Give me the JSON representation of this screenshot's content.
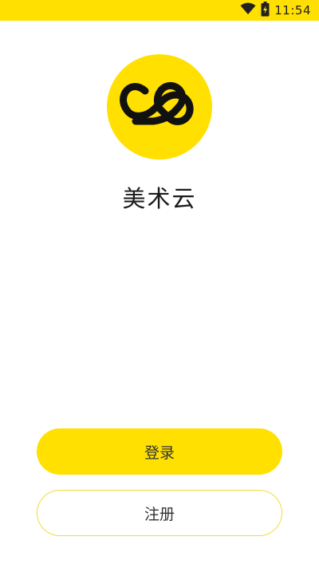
{
  "status_bar": {
    "time": "11:54",
    "icons": [
      "wifi-icon",
      "battery-icon"
    ]
  },
  "app": {
    "logo_icon": "cloud-infinity-logo",
    "name": "美术云"
  },
  "actions": {
    "login_label": "登录",
    "register_label": "注册"
  },
  "colors": {
    "brand_yellow": "#ffe000",
    "register_border": "#f3dc3a",
    "text": "#333333"
  }
}
